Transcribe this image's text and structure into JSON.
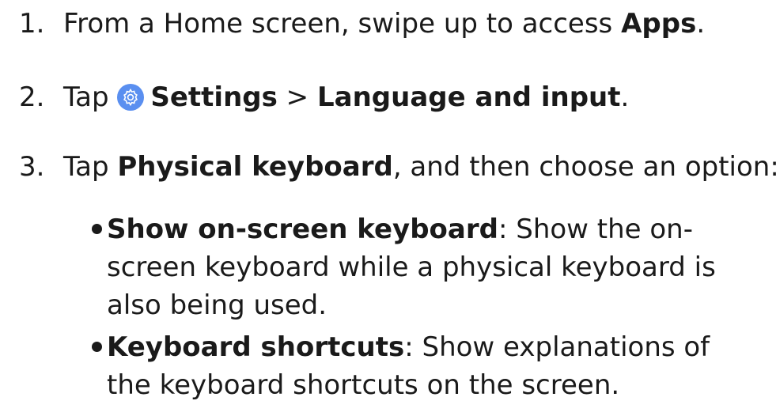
{
  "steps": [
    {
      "number": "1.",
      "prefix": "From a Home screen, swipe up to access ",
      "bold": "Apps",
      "suffix": "."
    },
    {
      "number": "2.",
      "prefix": "Tap ",
      "icon": "settings-gear-icon",
      "bold1": "Settings",
      "separator": " > ",
      "bold2": "Language and input",
      "suffix": "."
    },
    {
      "number": "3.",
      "prefix": "Tap ",
      "bold": "Physical keyboard",
      "suffix": ", and then choose an option:"
    }
  ],
  "options": [
    {
      "title": "Show on-screen keyboard",
      "description": ": Show the on-screen keyboard while a physical keyboard is also being used."
    },
    {
      "title": "Keyboard shortcuts",
      "description": ": Show explanations of the keyboard shortcuts on the screen."
    }
  ],
  "colors": {
    "text": "#1a1a1a",
    "icon_bg": "#5a8ff0"
  }
}
